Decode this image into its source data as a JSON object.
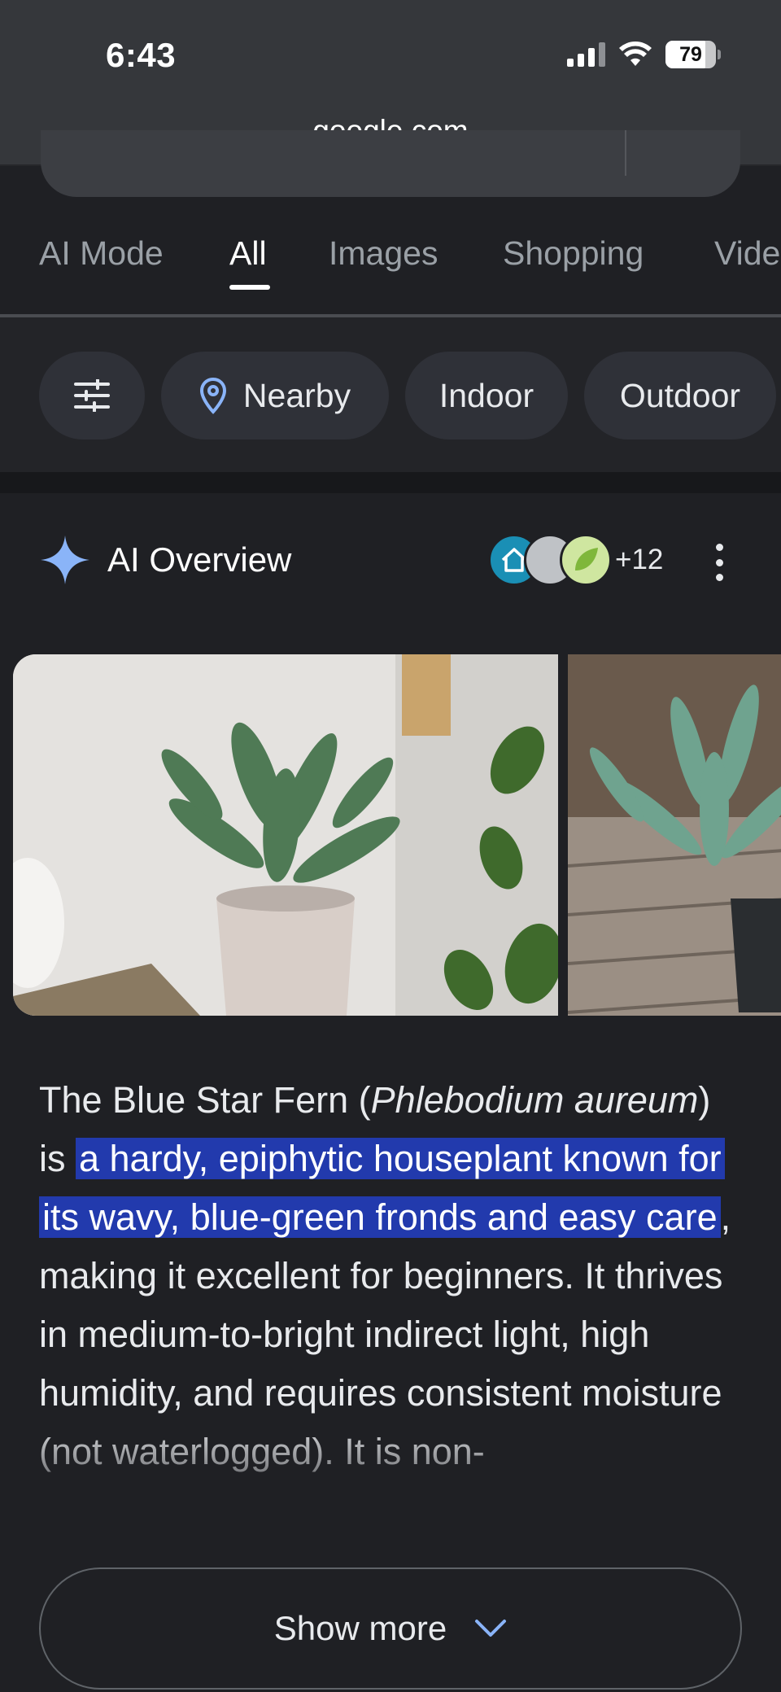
{
  "status_bar": {
    "time": "6:43",
    "battery": "79"
  },
  "browser": {
    "url": "google.com"
  },
  "tabs": [
    {
      "label": "AI Mode",
      "active": false
    },
    {
      "label": "All",
      "active": true
    },
    {
      "label": "Images",
      "active": false
    },
    {
      "label": "Shopping",
      "active": false
    },
    {
      "label": "Vide",
      "active": false
    }
  ],
  "chips": [
    {
      "label": "",
      "icon": "filter-sliders-icon"
    },
    {
      "label": "Nearby",
      "icon": "location-pin-icon"
    },
    {
      "label": "Indoor"
    },
    {
      "label": "Outdoor"
    }
  ],
  "ai_overview": {
    "title": "AI Overview",
    "source_count": "+12",
    "text_lead": "The Blue Star Fern (",
    "text_italic": "Phlebodium aureum",
    "text_after_italic": ") is ",
    "text_highlight": "a hardy, epiphytic houseplant known for its wavy, blue-green fronds and easy care",
    "text_rest": ", making it excellent for beginners. It thrives in medium-to-bright indirect light, high humidity, and requires consistent moisture (not waterlogged). It is non-",
    "show_more_label": "Show more"
  },
  "colors": {
    "accent_sparkle": "#8ab4f8",
    "highlight": "#223aad",
    "background": "#1f2024"
  }
}
